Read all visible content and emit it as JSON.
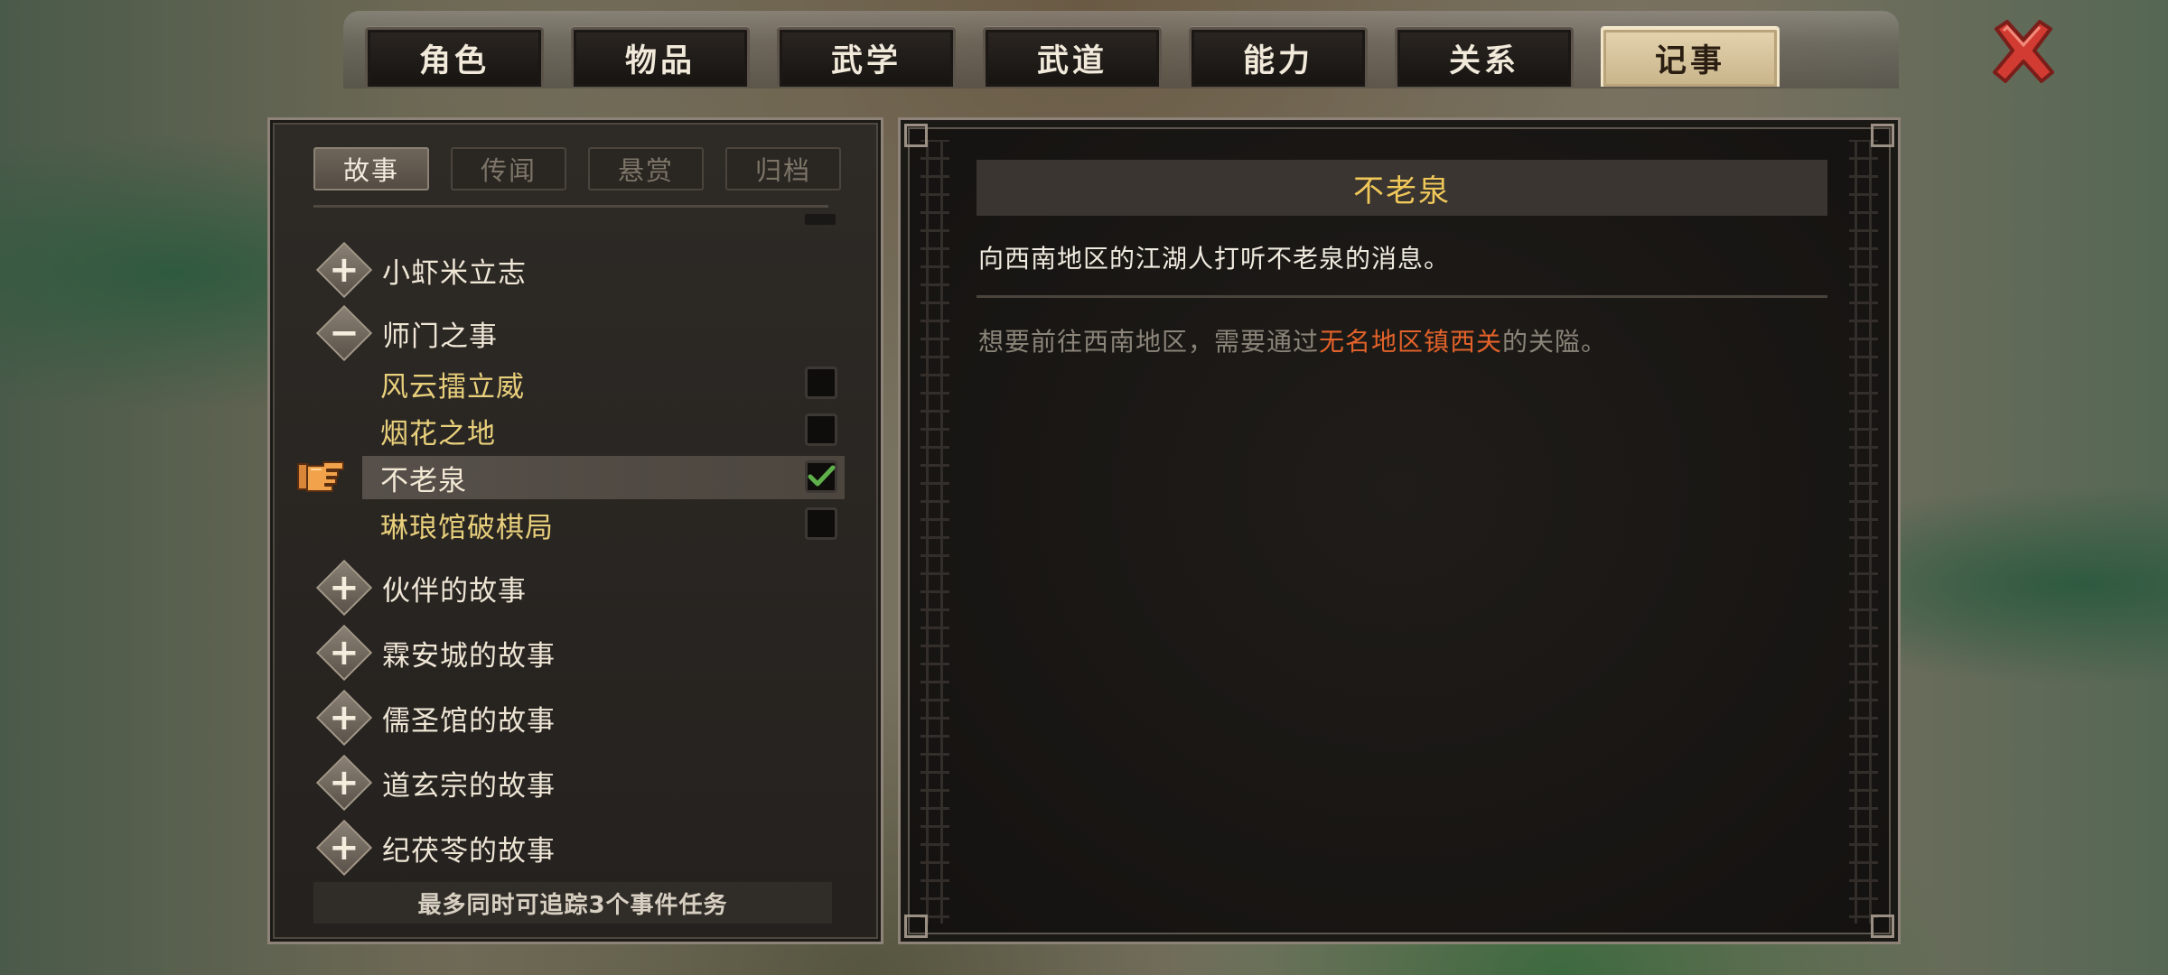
{
  "main_tabs": [
    {
      "label": "角色",
      "active": false
    },
    {
      "label": "物品",
      "active": false
    },
    {
      "label": "武学",
      "active": false
    },
    {
      "label": "武道",
      "active": false
    },
    {
      "label": "能力",
      "active": false
    },
    {
      "label": "关系",
      "active": false
    },
    {
      "label": "记事",
      "active": true
    }
  ],
  "close_icon": "close-x-icon",
  "sub_tabs": [
    {
      "label": "故事",
      "active": true
    },
    {
      "label": "传闻",
      "active": false
    },
    {
      "label": "悬赏",
      "active": false
    },
    {
      "label": "归档",
      "active": false
    }
  ],
  "tree": {
    "cat_1": {
      "label": "小虾米立志",
      "expanded": false
    },
    "cat_2": {
      "label": "师门之事",
      "expanded": true
    },
    "quests": [
      {
        "label": "风云擂立威",
        "checked": false
      },
      {
        "label": "烟花之地",
        "checked": false
      },
      {
        "label": "不老泉",
        "checked": true,
        "selected": true
      },
      {
        "label": "琳琅馆破棋局",
        "checked": false
      }
    ],
    "cat_3": {
      "label": "伙伴的故事",
      "expanded": false
    },
    "cat_4": {
      "label": "霖安城的故事",
      "expanded": false
    },
    "cat_5": {
      "label": "儒圣馆的故事",
      "expanded": false
    },
    "cat_6": {
      "label": "道玄宗的故事",
      "expanded": false
    },
    "cat_7": {
      "label": "纪茯苓的故事",
      "expanded": false
    },
    "expand_symbol": "+",
    "collapse_symbol": "−"
  },
  "footer_note": "最多同时可追踪3个事件任务",
  "detail": {
    "title": "不老泉",
    "description": "向西南地区的江湖人打听不老泉的消息。",
    "hint_prefix": "想要前往西南地区，需要通过",
    "hint_highlight": "无名地区镇西关",
    "hint_suffix": "的关隘。"
  },
  "colors": {
    "accent_gold": "#f0c85a",
    "quest_yellow": "#e8cf7b",
    "highlight_orange": "#e2622a",
    "check_green": "#5fb04a",
    "close_red": "#d23b32"
  }
}
